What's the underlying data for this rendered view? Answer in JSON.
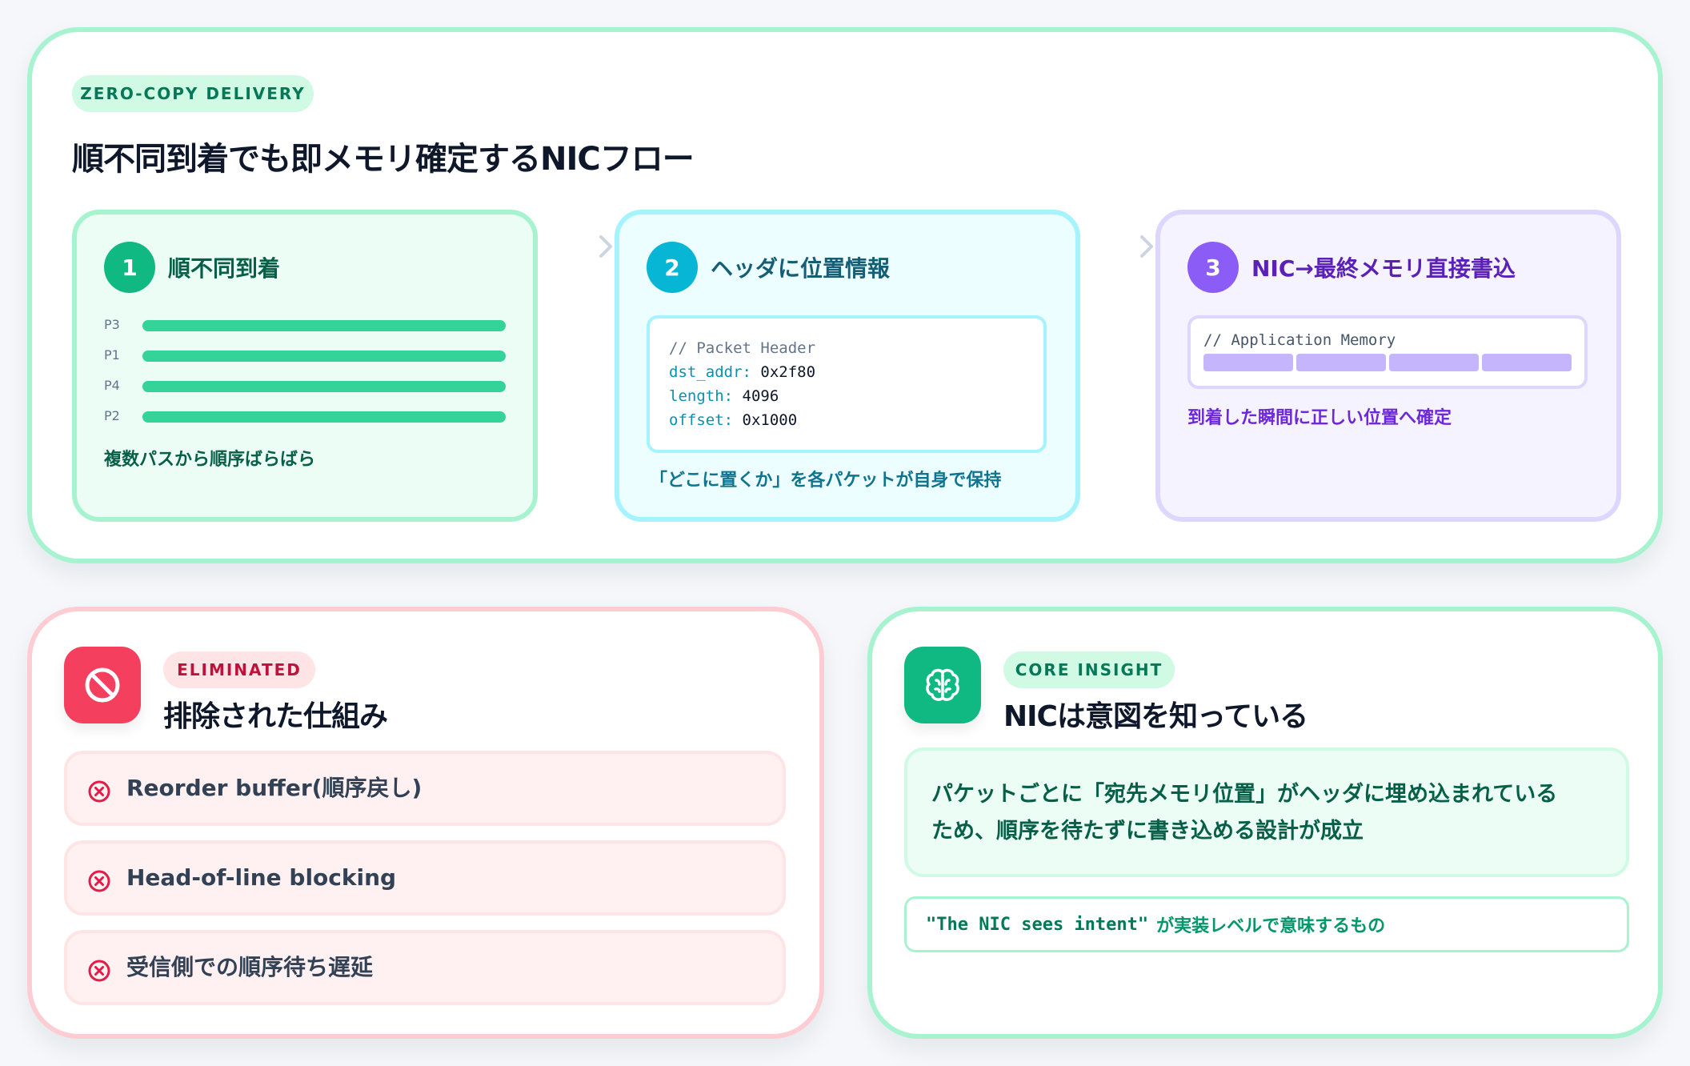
{
  "top": {
    "badge": "ZERO-COPY DELIVERY",
    "title": "順不同到着でも即メモリ確定するNICフロー",
    "steps": [
      {
        "number": "1",
        "title": "順不同到着",
        "packets": [
          "P3",
          "P1",
          "P4",
          "P2"
        ],
        "note": "複数パスから順序ばらばら"
      },
      {
        "number": "2",
        "title": "ヘッダに位置情報",
        "code": {
          "comment": "// Packet Header",
          "fields": [
            {
              "key": "dst_addr:",
              "value": "0x2f80"
            },
            {
              "key": "length:",
              "value": "4096"
            },
            {
              "key": "offset:",
              "value": "0x1000"
            }
          ]
        },
        "note": "「どこに置くか」を各パケットが自身で保持"
      },
      {
        "number": "3",
        "title": "NIC→最終メモリ直接書込",
        "memory_label": "// Application Memory",
        "memory_slots_filled": 4,
        "note": "到着した瞬間に正しい位置へ確定"
      }
    ]
  },
  "eliminated": {
    "badge": "ELIMINATED",
    "title": "排除された仕組み",
    "icon": "ban-icon",
    "items": [
      "Reorder buffer(順序戻し)",
      "Head-of-line blocking",
      "受信側での順序待ち遅延"
    ]
  },
  "insight": {
    "badge": "CORE INSIGHT",
    "title": "NICは意図を知っている",
    "icon": "brain-icon",
    "body_lines": [
      "パケットごとに「宛先メモリ位置」がヘッダに埋め込まれている",
      "ため、順序を待たずに書き込める設計が成立"
    ],
    "quote_en": "\"The NIC sees intent\"",
    "quote_jp": "が実装レベルで意味するもの"
  },
  "colors": {
    "green_accent": "#10b981",
    "cyan_accent": "#06b6d4",
    "purple_accent": "#8b5cf6",
    "rose_accent": "#f43f5e"
  }
}
